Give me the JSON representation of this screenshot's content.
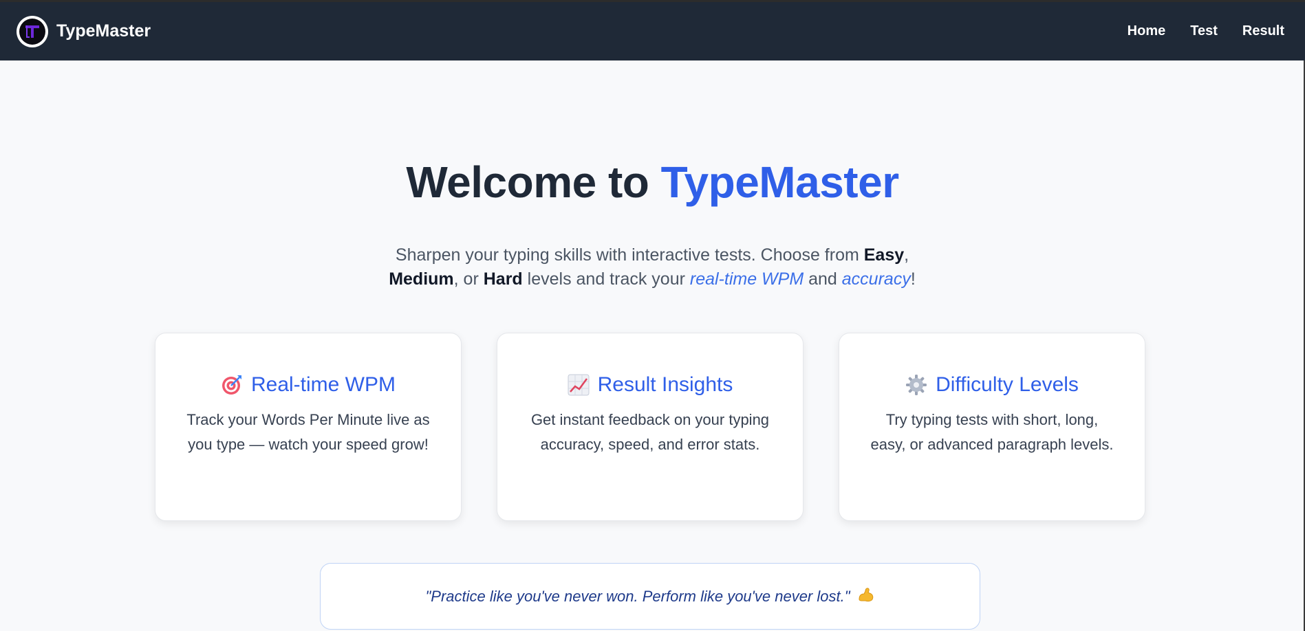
{
  "navbar": {
    "brand": "TypeMaster",
    "links": [
      "Home",
      "Test",
      "Result"
    ]
  },
  "hero": {
    "title_prefix": "Welcome to ",
    "title_accent": "TypeMaster",
    "sub": {
      "part1": "Sharpen your typing skills with interactive tests. Choose from ",
      "easy": "Easy",
      "comma1": ",",
      "medium": "Medium",
      "part2": ", or ",
      "hard": "Hard",
      "part3": " levels and track your ",
      "wpm": "real-time WPM",
      "and": " and ",
      "accuracy": "accuracy",
      "end": "!"
    }
  },
  "cards": [
    {
      "icon": "target-icon",
      "title": "Real-time WPM",
      "desc": "Track your Words Per Minute live as you type — watch your speed grow!"
    },
    {
      "icon": "chart-increasing-icon",
      "title": "Result Insights",
      "desc": "Get instant feedback on your typing accuracy, speed, and error stats."
    },
    {
      "icon": "gear-icon",
      "title": "Difficulty Levels",
      "desc": "Try typing tests with short, long, easy, or advanced paragraph levels."
    }
  ],
  "quote": {
    "text": "\"Practice like you've never won. Perform like you've never lost.\"",
    "icon": "flexed-biceps-icon"
  },
  "colors": {
    "navbar_bg": "#1f2937",
    "accent": "#2f5fe8",
    "page_bg": "#f8f9fb"
  }
}
